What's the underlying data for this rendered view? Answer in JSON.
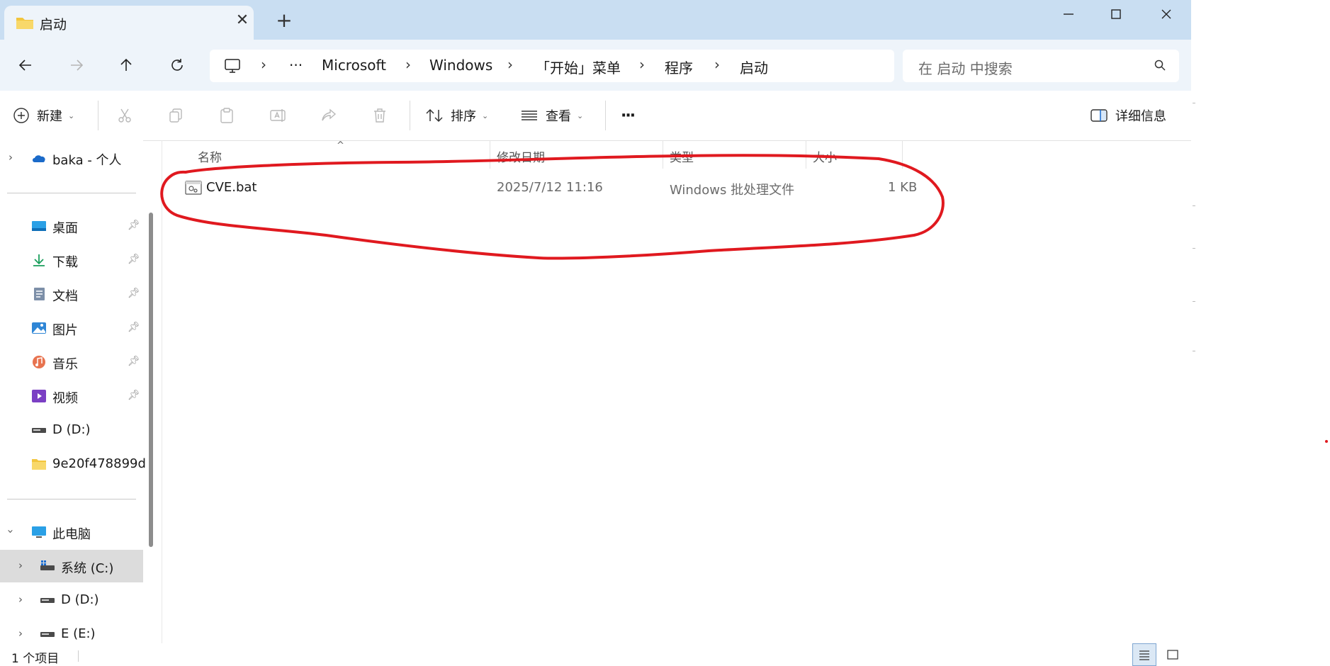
{
  "window": {
    "tab_title": "启动",
    "new_tab_label": "+",
    "tab_close_label": "✕"
  },
  "address": {
    "overflow": "···",
    "crumbs": [
      "Microsoft",
      "Windows",
      "「开始」菜单",
      "程序",
      "启动"
    ]
  },
  "search": {
    "placeholder": "在 启动 中搜索"
  },
  "commands": {
    "new": "新建",
    "sort": "排序",
    "view": "查看",
    "more": "···",
    "details": "详细信息"
  },
  "sidebar": {
    "onedrive": "baka - 个人",
    "quick": [
      {
        "label": "桌面",
        "icon": "desktop-icon"
      },
      {
        "label": "下载",
        "icon": "download-icon"
      },
      {
        "label": "文档",
        "icon": "document-icon"
      },
      {
        "label": "图片",
        "icon": "pictures-icon"
      },
      {
        "label": "音乐",
        "icon": "music-icon"
      },
      {
        "label": "视频",
        "icon": "video-icon"
      }
    ],
    "drive_d": "D (D:)",
    "folder": "9e20f478899d",
    "this_pc": "此电脑",
    "drives": [
      "系统 (C:)",
      "D (D:)",
      "E (E:)"
    ]
  },
  "columns": {
    "name": "名称",
    "modified": "修改日期",
    "type": "类型",
    "size": "大小"
  },
  "files": [
    {
      "name": "CVE.bat",
      "modified": "2025/7/12 11:16",
      "type": "Windows 批处理文件",
      "size": "1 KB"
    }
  ],
  "status": {
    "count": "1 个项目"
  },
  "colors": {
    "titlebar": "#c9def2",
    "navbar": "#eef4fa",
    "annotation": "#e0191f",
    "selected": "#dcdcdc"
  }
}
